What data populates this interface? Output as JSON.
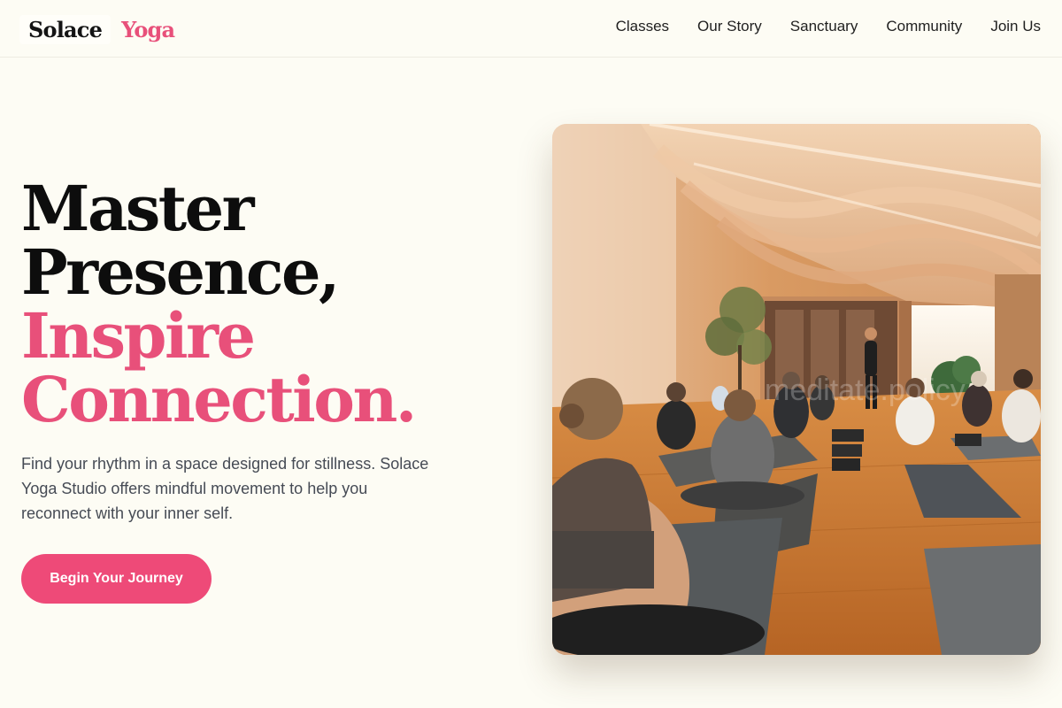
{
  "header": {
    "logo": {
      "word_1": "Solace",
      "word_2": "Yoga"
    },
    "nav": [
      {
        "label": "Classes"
      },
      {
        "label": "Our Story"
      },
      {
        "label": "Sanctuary"
      },
      {
        "label": "Community"
      },
      {
        "label": "Join Us"
      }
    ]
  },
  "hero": {
    "headline": {
      "line_1": "Master",
      "line_2": "Presence,",
      "line_3": "Inspire",
      "line_4": "Connection."
    },
    "subtext": "Find your rhythm in a space designed for stillness. Solace Yoga Studio offers mindful movement to help you reconnect with your inner self.",
    "cta_label": "Begin Your Journey",
    "image": {
      "watermark": "meditate.policy"
    }
  },
  "colors": {
    "background": "#fdfcf4",
    "accent": "#e8507a",
    "button": "#ee4a78",
    "text_dark": "#0d0d0d",
    "text_muted": "#464b55"
  }
}
